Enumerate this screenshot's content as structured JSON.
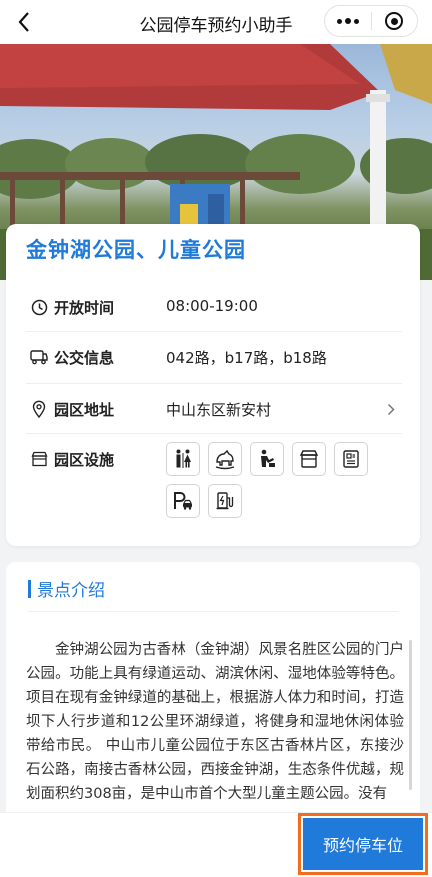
{
  "nav": {
    "title": "公园停车预约小助手"
  },
  "park": {
    "name": "金钟湖公园、儿童公园",
    "rows": {
      "hours": {
        "label": "开放时间",
        "value": "08:00-19:00",
        "icon": "clock-icon"
      },
      "transit": {
        "label": "公交信息",
        "value": "042路，b17路，b18路",
        "icon": "bus-icon"
      },
      "address": {
        "label": "园区地址",
        "value": "中山东区新安村",
        "icon": "location-pin-icon"
      },
      "facilities": {
        "label": "园区设施",
        "icon": "shop-icon"
      }
    },
    "facilities": [
      "restroom-icon",
      "playground-icon",
      "baby-care-icon",
      "shop-icon",
      "info-board-icon",
      "parking-icon",
      "ev-charging-icon"
    ]
  },
  "intro": {
    "title": "景点介绍",
    "text": "金钟湖公园为古香林（金钟湖）风景名胜区公园的门户公园。功能上具有绿道运动、湖滨休闲、湿地体验等特色。项目在现有金钟绿道的基础上，根据游人体力和时间，打造坝下人行步道和12公里环湖绿道，将健身和湿地休闲体验带给市民。 中山市儿童公园位于东区古香林片区，东接沙石公路，南接古香林公园，西接金钟湖，生态条件优越，规划面积约308亩，是中山市首个大型儿童主题公园。没有"
  },
  "bottom": {
    "reserve_label": "预约停车位"
  },
  "colors": {
    "accent": "#1f7ad9",
    "highlight": "#f26d21"
  }
}
